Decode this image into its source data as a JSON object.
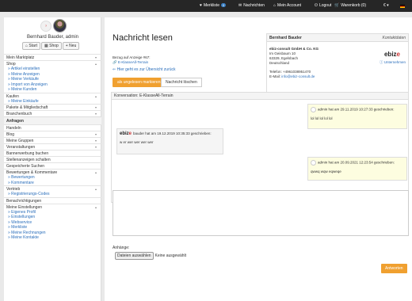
{
  "topbar": {
    "merkliste": "Merkliste",
    "merkliste_count": "0",
    "nachrichten": "Nachrichten",
    "account": "Mein Account",
    "logout": "Logout",
    "warenkorb": "Warenkorb (0)",
    "currency": "€"
  },
  "sidebar": {
    "avatar_placeholder": "? ",
    "username": "Bernhard Bauder, admin",
    "buttons": [
      "Start",
      "Shop",
      "Neu"
    ],
    "marktplatz": "Mein Marktplatz",
    "shop": "Shop",
    "shop_sub": [
      "Artikel einstellen",
      "Meine Anzeigen",
      "Meine Verkäufe",
      "Import von Anzeigen",
      "Meine Kunden"
    ],
    "kaufen": "Kaufen",
    "kaufen_sub": [
      "Meine Einkäufe"
    ],
    "pakete": "Pakete & Mitgliedschaft",
    "branchenbuch": "Branchenbuch",
    "anfragen": "Anfragen",
    "items2": [
      "Handeln",
      "Blog",
      "Meine Gruppen",
      "Veranstaltungen",
      "Bannerwerbung buchen",
      "Stellenanzeigen schalten",
      "Gespeicherte Suchen",
      "Bewertungen & Kommentare"
    ],
    "bewertungen_sub": [
      "Bewertungen",
      "Kommentare"
    ],
    "vertrieb": "Vertrieb",
    "vertrieb_sub": [
      "Registrierungs-Codes"
    ],
    "benachrichtigungen": "Benachrichtigungen",
    "einstellungen": "Meine Einstellungen",
    "einstellungen_sub": [
      "Eigenes Profil",
      "Einstellungen",
      "Webservice",
      "Merkliste",
      "Meine Rechnungen",
      "Meine Kontakte"
    ]
  },
  "main": {
    "title": "Nachricht lesen",
    "bezug": "Bezug auf Anzeige #67:",
    "anzeige_link": "E-KlasseAll-Terrain",
    "back": "Hier geht es zur Übersicht zurück",
    "mark_unread": "als ungelesen markieren",
    "delete": "Nachricht löschen"
  },
  "contact": {
    "name": "Bernhard Bauder",
    "tag": "Kontaktdaten",
    "company": "ebiz-consult GmbH & Co. KG",
    "street": "Im Geisbaum 10",
    "city": "63329, Egelsbach",
    "country": "Deutschland",
    "phone": "Telefon: +4961038951470",
    "email_label": "E-Mail: ",
    "email": "info@ebiz-consult.de",
    "logo_main": "ebiz",
    "logo_accent": "e",
    "unternehmen": "Unternehmen"
  },
  "conversation": {
    "title": "Konversation: E-KlasseAll-Terrain",
    "messages": [
      {
        "head": "admin hat am 29.11.2019 10:27:33 geschrieben:",
        "text": "lol lol lol lol lol"
      },
      {
        "logo": "ebiz",
        "logo_accent": "e",
        "head": "bauder hat am 19.12.2019 10:35:33 geschrieben:",
        "text": "w er wer wer wer wer"
      },
      {
        "head": "admin hat am 20.09.2021 12:23:54 geschrieben:",
        "text": "qwwq wqw eqweqe"
      }
    ]
  },
  "reply": {
    "anhaenge": "Anhänge:",
    "file_button": "Dateien auswählen",
    "file_status": "Keine ausgewählt",
    "send": "Antworten"
  }
}
